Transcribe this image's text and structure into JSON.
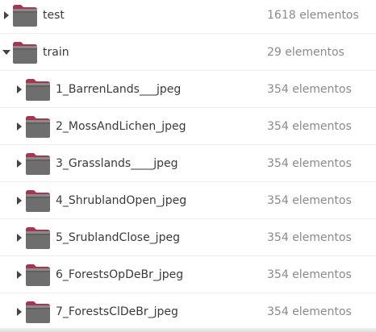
{
  "rows": [
    {
      "name": "test",
      "size": "1618 elementos",
      "expanded": false,
      "depth": 0
    },
    {
      "name": "train",
      "size": "29 elementos",
      "expanded": true,
      "depth": 0
    },
    {
      "name": "1_BarrenLands___jpeg",
      "size": "354 elementos",
      "expanded": false,
      "depth": 1
    },
    {
      "name": "2_MossAndLichen_jpeg",
      "size": "354 elementos",
      "expanded": false,
      "depth": 1
    },
    {
      "name": "3_Grasslands____jpeg",
      "size": "354 elementos",
      "expanded": false,
      "depth": 1
    },
    {
      "name": "4_ShrublandOpen_jpeg",
      "size": "354 elementos",
      "expanded": false,
      "depth": 1
    },
    {
      "name": "5_SrublandClose_jpeg",
      "size": "354 elementos",
      "expanded": false,
      "depth": 1
    },
    {
      "name": "6_ForestsOpDeBr_jpeg",
      "size": "354 elementos",
      "expanded": false,
      "depth": 1
    },
    {
      "name": "7_ForestsClDeBr_jpeg",
      "size": "354 elementos",
      "expanded": false,
      "depth": 1
    }
  ],
  "icons": {
    "folder": "folder-icon",
    "expanded": "chevron-down-icon",
    "collapsed": "chevron-right-icon"
  },
  "colors": {
    "folder_body": "#6e6e6e",
    "folder_back": "#8a8a8a",
    "folder_tab": "#a8344f",
    "folder_edge": "#5a5a5a"
  }
}
